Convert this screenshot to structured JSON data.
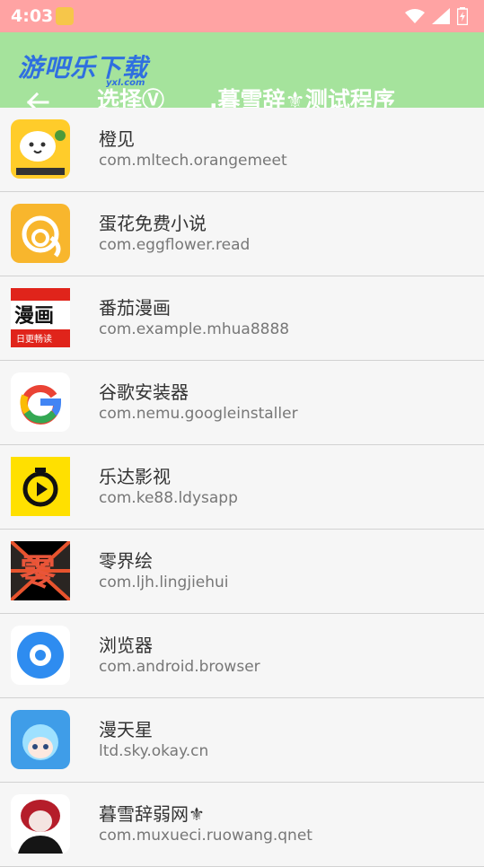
{
  "status_bar": {
    "time": "4:03"
  },
  "watermark": {
    "text": "游吧乐下载",
    "sub": "yxl.com"
  },
  "app_bar": {
    "title": "选择Ⓥ　　.暮雪辞⚜测试程序",
    "color": "#a5e39c"
  },
  "apps": [
    {
      "name": "橙见",
      "package": "com.mltech.orangemeet",
      "icon": "orange-meet-icon"
    },
    {
      "name": "蛋花免费小说",
      "package": "com.eggflower.read",
      "icon": "egg-flower-icon"
    },
    {
      "name": "番茄漫画",
      "package": "com.example.mhua8888",
      "icon": "tomato-comic-icon",
      "icon_text": "漫画",
      "icon_sub": "日更畅读"
    },
    {
      "name": "谷歌安装器",
      "package": "com.nemu.googleinstaller",
      "icon": "google-icon"
    },
    {
      "name": "乐达影视",
      "package": "com.ke88.ldysapp",
      "icon": "play-timer-icon"
    },
    {
      "name": "零界绘",
      "package": "com.ljh.lingjiehui",
      "icon": "lingjie-icon",
      "icon_text": "零"
    },
    {
      "name": "浏览器",
      "package": "com.android.browser",
      "icon": "browser-icon"
    },
    {
      "name": "漫天星",
      "package": "ltd.sky.okay.cn",
      "icon": "anime-girl-icon"
    },
    {
      "name": "暮雪辞弱网⚜",
      "package": "com.muxueci.ruowang.qnet",
      "icon": "avatar-icon"
    }
  ]
}
